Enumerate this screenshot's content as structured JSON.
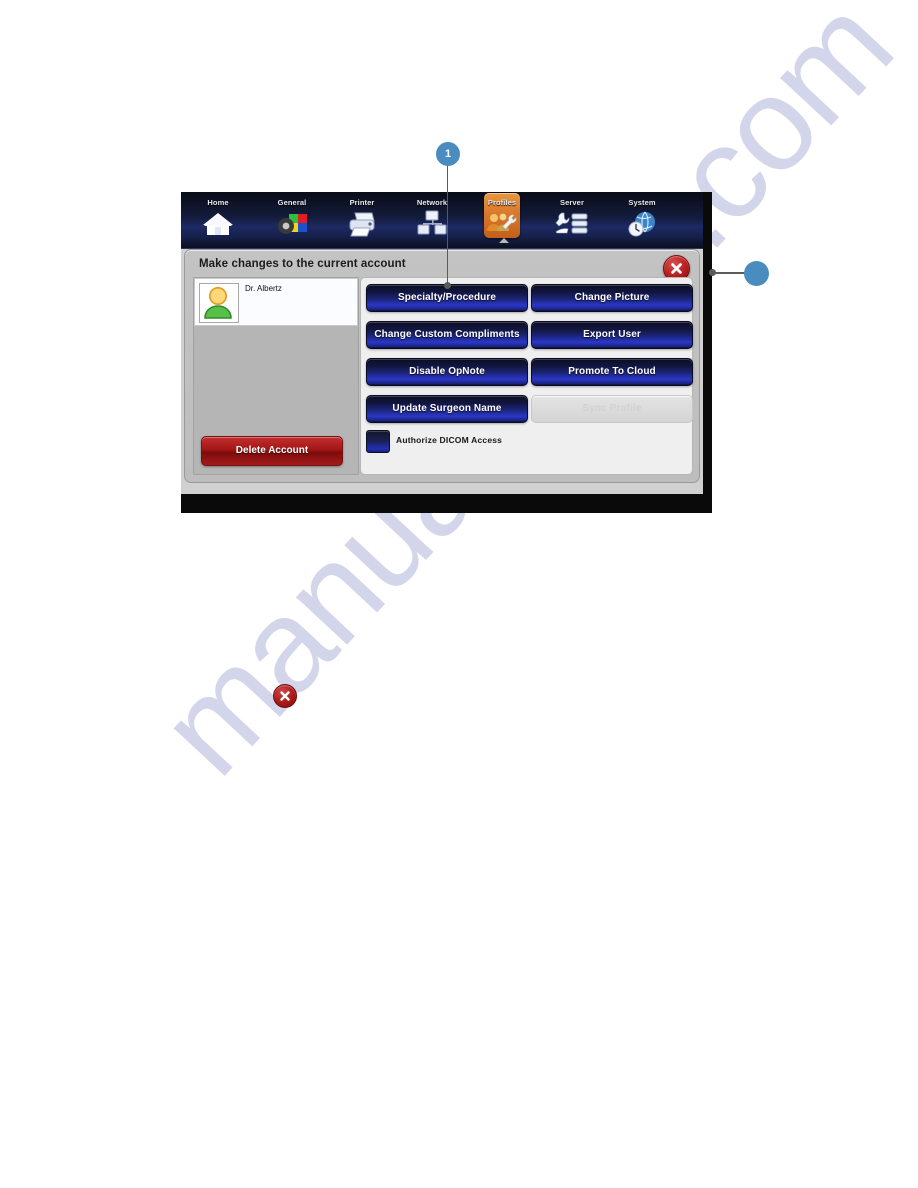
{
  "watermark": {
    "text": "manualshive.com"
  },
  "device": {
    "topbar": {
      "items": [
        {
          "label": "Home",
          "icon": "house-icon",
          "active": false
        },
        {
          "label": "General",
          "icon": "color-wheel-icon",
          "active": false
        },
        {
          "label": "Printer",
          "icon": "printer-icon",
          "active": false
        },
        {
          "label": "Network",
          "icon": "network-icon",
          "active": false
        },
        {
          "label": "Profiles",
          "icon": "users-wrench-icon",
          "active": true
        },
        {
          "label": "Server",
          "icon": "server-wrench-icon",
          "active": false
        },
        {
          "label": "System",
          "icon": "globe-clock-icon",
          "active": false
        }
      ]
    },
    "dialog": {
      "title": "Make changes to the current account",
      "close_icon": "close-x-icon",
      "user": {
        "name": "Dr. Albertz",
        "avatar_icon": "person-avatar-icon"
      },
      "delete_button": "Delete Account",
      "actions": [
        {
          "label": "Specialty/Procedure",
          "disabled": false
        },
        {
          "label": "Change Picture",
          "disabled": false
        },
        {
          "label": "Change Custom Compliments",
          "disabled": false
        },
        {
          "label": "Export User",
          "disabled": false
        },
        {
          "label": "Disable OpNote",
          "disabled": false
        },
        {
          "label": "Promote To Cloud",
          "disabled": false
        },
        {
          "label": "Update Surgeon Name",
          "disabled": false
        },
        {
          "label": "Sync Profile",
          "disabled": true
        }
      ],
      "checkbox": {
        "label": "Authorize DICOM Access",
        "checked": false
      }
    }
  },
  "callouts": [
    {
      "number": "1"
    },
    {
      "number": ""
    }
  ],
  "body_icon": {
    "name": "close-x-icon"
  },
  "colors": {
    "accent_blue": "#4a8cc0",
    "active_tab_orange": "#d8762a",
    "danger_red": "#a41616",
    "button_blue": "#2a37c8",
    "watermark": "#b9bce0"
  }
}
